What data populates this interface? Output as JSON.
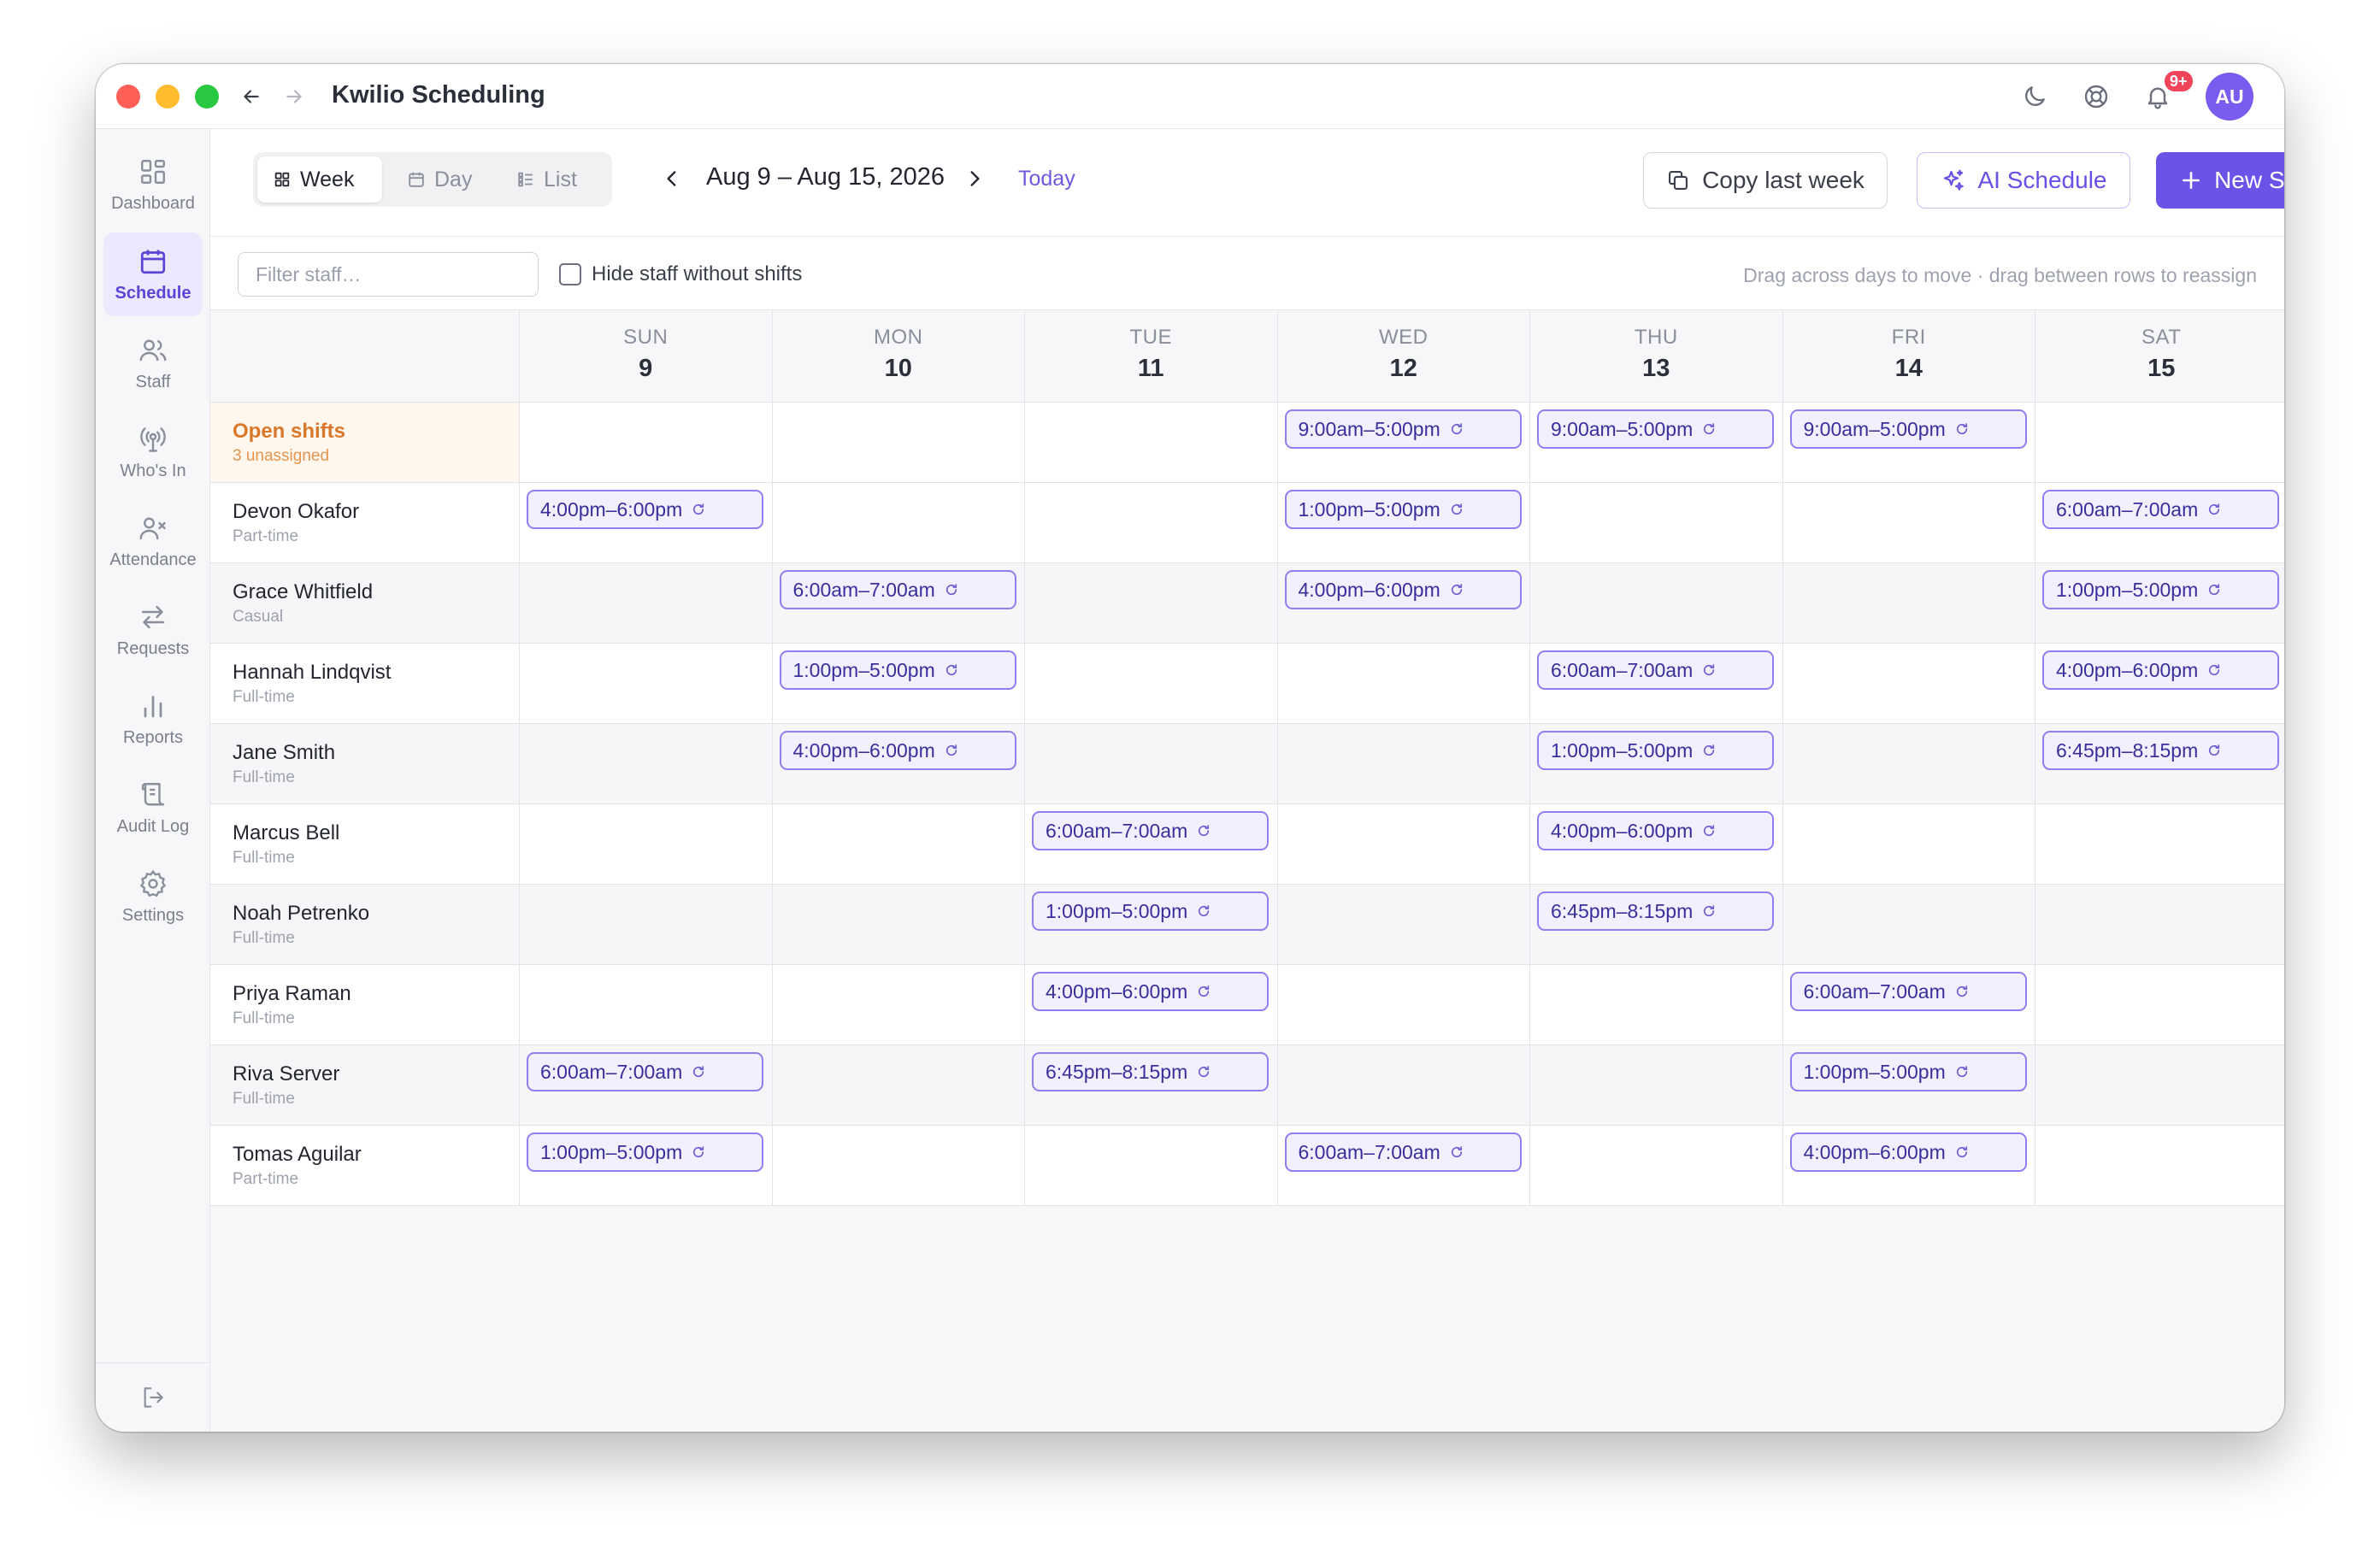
{
  "window": {
    "title": "Kwilio Scheduling",
    "notifications_badge": "9+",
    "avatar_initials": "AU",
    "accent_color": "#6c53e8",
    "icons": [
      "moon-icon",
      "help-icon",
      "bell-icon"
    ]
  },
  "sidebar": {
    "items": [
      {
        "label": "Dashboard",
        "icon": "dashboard-icon"
      },
      {
        "label": "Schedule",
        "icon": "calendar-icon",
        "active": true
      },
      {
        "label": "Staff",
        "icon": "users-icon"
      },
      {
        "label": "Who's In",
        "icon": "broadcast-icon"
      },
      {
        "label": "Attendance",
        "icon": "user-x-icon"
      },
      {
        "label": "Requests",
        "icon": "swap-icon"
      },
      {
        "label": "Reports",
        "icon": "bar-chart-icon"
      },
      {
        "label": "Audit Log",
        "icon": "scroll-icon"
      },
      {
        "label": "Settings",
        "icon": "gear-icon"
      }
    ],
    "logout_icon": "logout-icon"
  },
  "toolbar": {
    "views": [
      {
        "label": "Week",
        "icon": "grid-icon",
        "active": true
      },
      {
        "label": "Day",
        "icon": "calendar-icon"
      },
      {
        "label": "List",
        "icon": "list-icon"
      }
    ],
    "range_label": "Aug 9 – Aug 15, 2026",
    "today_label": "Today",
    "copy_label": "Copy last week",
    "ai_label": "AI Schedule",
    "new_label": "New Shift"
  },
  "filter": {
    "placeholder": "Filter staff…",
    "value": "",
    "hide_label": "Hide staff without shifts",
    "hide_checked": false,
    "hint": "Drag across days to move · drag between rows to reassign"
  },
  "days": [
    {
      "name": "SUN",
      "date": "9"
    },
    {
      "name": "MON",
      "date": "10"
    },
    {
      "name": "TUE",
      "date": "11"
    },
    {
      "name": "WED",
      "date": "12"
    },
    {
      "name": "THU",
      "date": "13"
    },
    {
      "name": "FRI",
      "date": "14"
    },
    {
      "name": "SAT",
      "date": "15"
    }
  ],
  "rows": [
    {
      "name": "Open shifts",
      "sub": "3 unassigned",
      "open": true,
      "shifts": [
        null,
        null,
        null,
        "9:00am–5:00pm",
        "9:00am–5:00pm",
        "9:00am–5:00pm",
        null
      ]
    },
    {
      "name": "Devon Okafor",
      "sub": "Part-time",
      "shifts": [
        "4:00pm–6:00pm",
        null,
        null,
        "1:00pm–5:00pm",
        null,
        null,
        "6:00am–7:00am"
      ]
    },
    {
      "name": "Grace Whitfield",
      "sub": "Casual",
      "shifts": [
        null,
        "6:00am–7:00am",
        null,
        "4:00pm–6:00pm",
        null,
        null,
        "1:00pm–5:00pm"
      ]
    },
    {
      "name": "Hannah Lindqvist",
      "sub": "Full-time",
      "shifts": [
        null,
        "1:00pm–5:00pm",
        null,
        null,
        "6:00am–7:00am",
        null,
        "4:00pm–6:00pm"
      ]
    },
    {
      "name": "Jane Smith",
      "sub": "Full-time",
      "shifts": [
        null,
        "4:00pm–6:00pm",
        null,
        null,
        "1:00pm–5:00pm",
        null,
        "6:45pm–8:15pm"
      ]
    },
    {
      "name": "Marcus Bell",
      "sub": "Full-time",
      "shifts": [
        null,
        null,
        "6:00am–7:00am",
        null,
        "4:00pm–6:00pm",
        null,
        null
      ]
    },
    {
      "name": "Noah Petrenko",
      "sub": "Full-time",
      "shifts": [
        null,
        null,
        "1:00pm–5:00pm",
        null,
        "6:45pm–8:15pm",
        null,
        null
      ]
    },
    {
      "name": "Priya Raman",
      "sub": "Full-time",
      "shifts": [
        null,
        null,
        "4:00pm–6:00pm",
        null,
        null,
        "6:00am–7:00am",
        null
      ]
    },
    {
      "name": "Riva Server",
      "sub": "Full-time",
      "shifts": [
        "6:00am–7:00am",
        null,
        "6:45pm–8:15pm",
        null,
        null,
        "1:00pm–5:00pm",
        null
      ]
    },
    {
      "name": "Tomas Aguilar",
      "sub": "Part-time",
      "shifts": [
        "1:00pm–5:00pm",
        null,
        null,
        "6:00am–7:00am",
        null,
        "4:00pm–6:00pm",
        null
      ]
    }
  ]
}
